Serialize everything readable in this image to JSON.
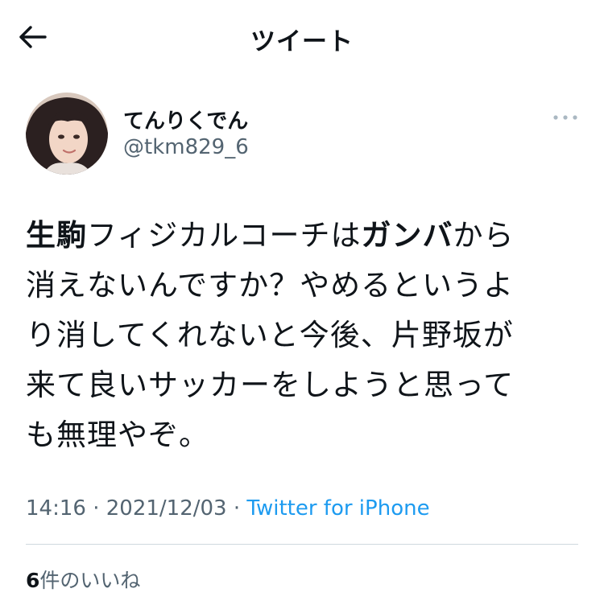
{
  "header": {
    "title": "ツイート",
    "back_icon": "arrow-left-icon"
  },
  "tweet": {
    "author_name": "てんりくでん",
    "author_handle": "@tkm829_6",
    "body": [
      {
        "text": "生駒",
        "bold": true
      },
      {
        "text": "フィジカルコーチは",
        "bold": false
      },
      {
        "text": "ガンバ",
        "bold": true
      },
      {
        "text": "から\n消えないんですか？やめるというよ\nり消してくれないと今後、片野坂が\n来て良いサッカーをしようと思って\nも無理やぞ。",
        "bold": false
      }
    ],
    "time": "14:16",
    "sep1": "·",
    "date": "2021/12/03",
    "sep2": "·",
    "source": "Twitter for iPhone",
    "likes_count": "6",
    "likes_label": "件のいいね"
  },
  "colors": {
    "text": "#0f1419",
    "secondary": "#536471",
    "link": "#1d9bf0",
    "divider": "#cfd9de"
  }
}
